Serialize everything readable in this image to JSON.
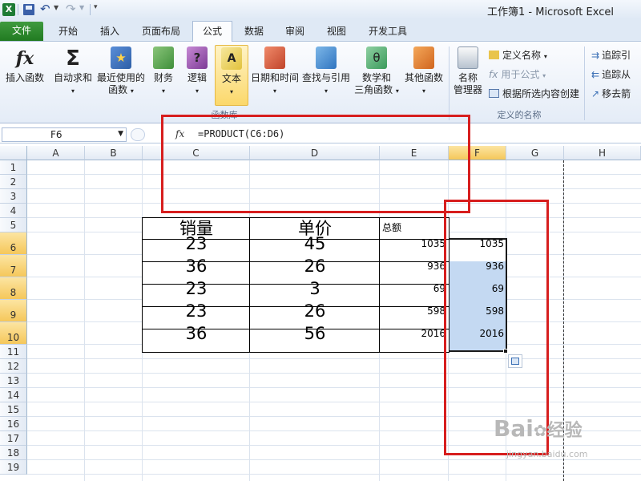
{
  "window": {
    "title": "工作簿1 - Microsoft Excel"
  },
  "tabs": [
    "文件",
    "开始",
    "插入",
    "页面布局",
    "公式",
    "数据",
    "审阅",
    "视图",
    "开发工具"
  ],
  "active_tab": "公式",
  "ribbon": {
    "insert_function": "插入函数",
    "autosum": "自动求和",
    "recent_1": "最近使用的",
    "recent_2": "函数",
    "finance": "财务",
    "logic": "逻辑",
    "text": "文本",
    "datetime": "日期和时间",
    "lookup": "查找与引用",
    "math_1": "数学和",
    "math_2": "三角函数",
    "other": "其他函数",
    "lib_group": "函数库",
    "name_mgr_1": "名称",
    "name_mgr_2": "管理器",
    "define_name": "定义名称",
    "use_in_formula": "用于公式",
    "create_from_sel": "根据所选内容创建",
    "names_group": "定义的名称",
    "trace_prec": "追踪引",
    "trace_dep": "追踪从",
    "remove_arrows": "移去箭"
  },
  "formula_bar": {
    "name_box": "F6",
    "fx": "fx",
    "formula": "=PRODUCT(C6:D6)"
  },
  "columns": [
    "A",
    "B",
    "C",
    "D",
    "E",
    "F",
    "G",
    "H"
  ],
  "rows": [
    "1",
    "2",
    "3",
    "4",
    "5",
    "6",
    "7",
    "8",
    "9",
    "10",
    "11",
    "12",
    "13",
    "14",
    "15",
    "16",
    "17",
    "18",
    "19"
  ],
  "table": {
    "headers": [
      "销量",
      "单价",
      "总额"
    ],
    "rows": [
      [
        "23",
        "45",
        "1035"
      ],
      [
        "36",
        "26",
        "936"
      ],
      [
        "23",
        "3",
        "69"
      ],
      [
        "23",
        "26",
        "598"
      ],
      [
        "36",
        "56",
        "2016"
      ]
    ]
  },
  "f_column": [
    "1035",
    "936",
    "69",
    "598",
    "2016"
  ],
  "watermark": {
    "brand": "Bai",
    "brand2": "经验",
    "site": "jingyan.baidu.com"
  },
  "colors": {
    "file_tab": "#2a7e2a",
    "highlight": "#f5c75a",
    "selection": "#c4d9f2",
    "red_box": "#d71e1e"
  }
}
